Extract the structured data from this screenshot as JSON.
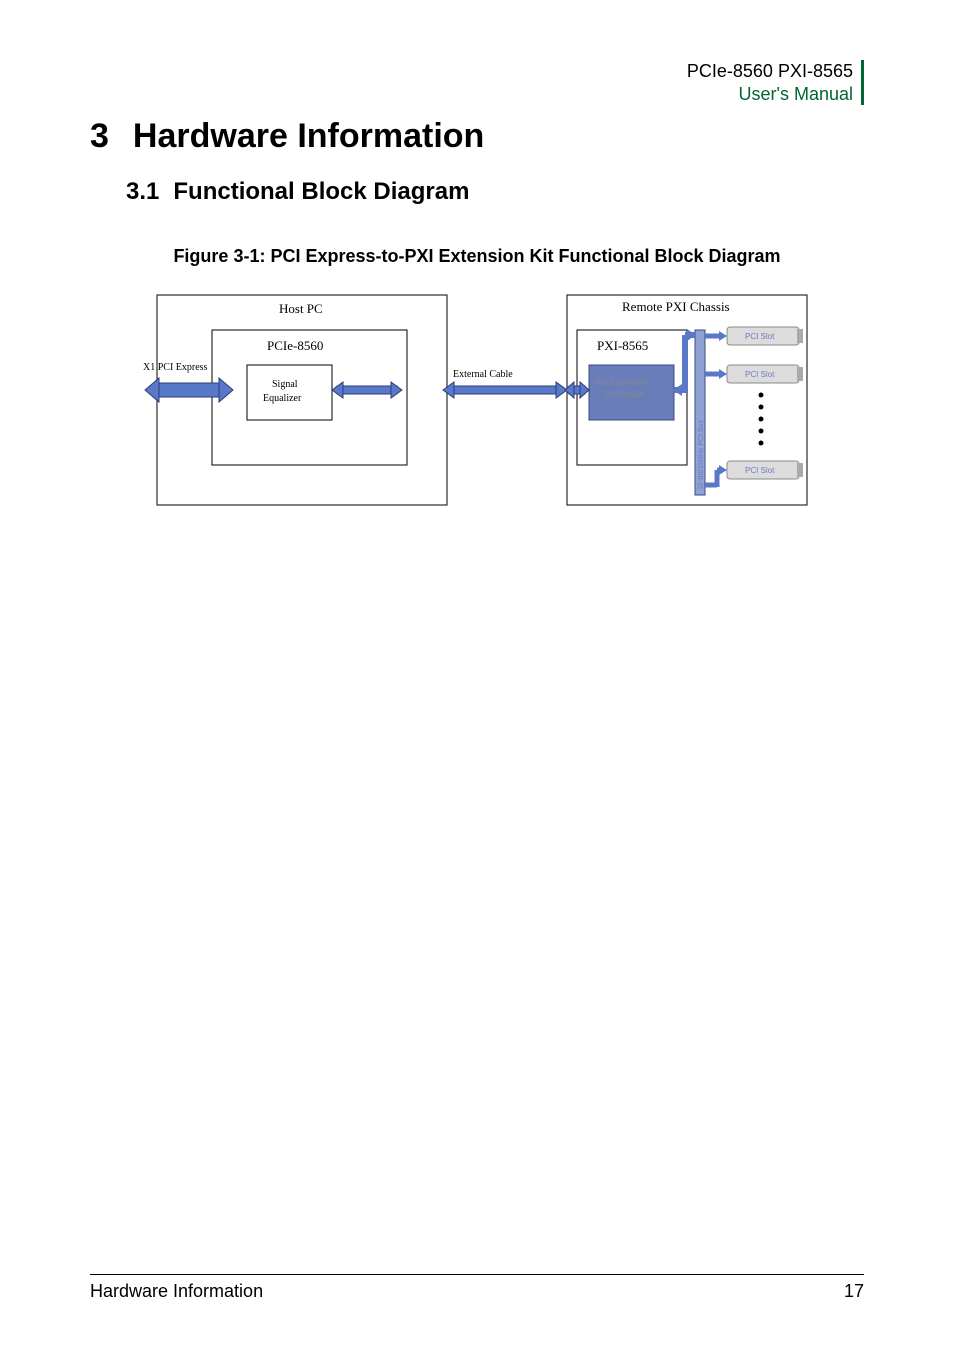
{
  "header": {
    "line1": "PCIe-8560 PXI-8565",
    "line2": "User's Manual"
  },
  "chapter": {
    "number": "3",
    "title": "Hardware Information"
  },
  "section": {
    "number": "3.1",
    "title": "Functional Block Diagram"
  },
  "figure": {
    "caption": "Figure 3-1: PCI Express-to-PXI Extension Kit Functional Block Diagram",
    "labels": {
      "host_pc": "Host PC",
      "pcie_8560": "PCIe-8560",
      "x1_pci_express": "X1 PCI Express",
      "signal_equalizer_l1": "Signal",
      "signal_equalizer_l2": "Equalizer",
      "external_cable": "External Cable",
      "remote_pxi_chassis": "Remote PXI Chassis",
      "pxi_8565": "PXI-8565",
      "pci_express_to_l1": "PCI Express-to",
      "pci_express_to_l2": "PCI Bridge",
      "pci_slot": "PCI Slot",
      "bus_label": "32-Bit/33MHz PCI Bus"
    }
  },
  "footer": {
    "left": "Hardware Information",
    "right": "17"
  }
}
